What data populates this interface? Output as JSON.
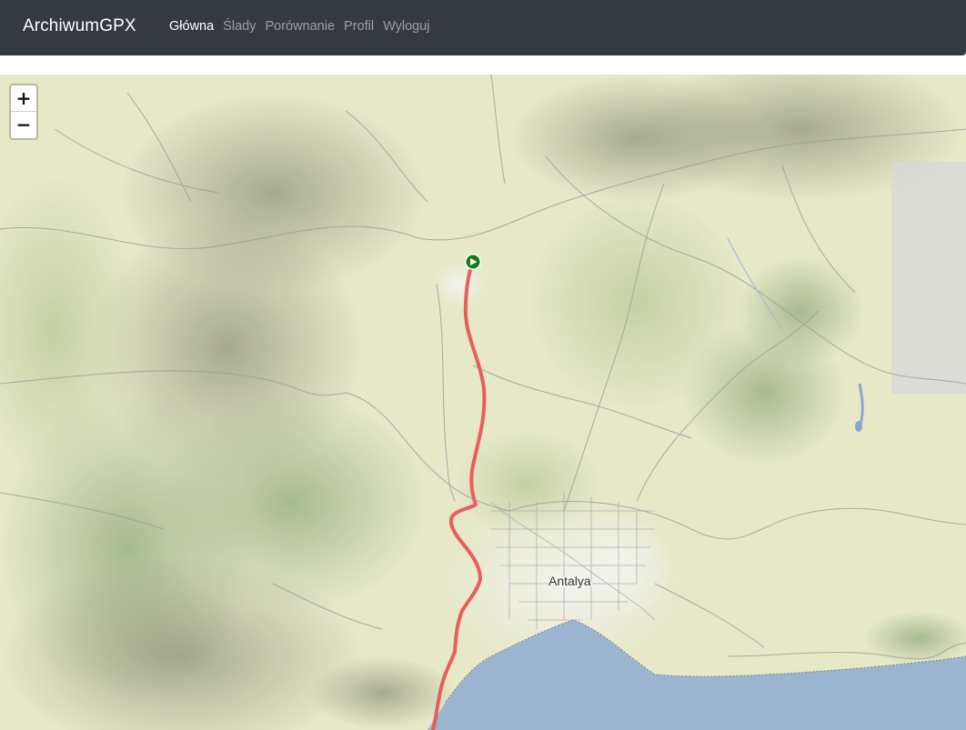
{
  "app": {
    "brand": "ArchiwumGPX"
  },
  "nav": {
    "items": [
      {
        "label": "Główna",
        "active": true
      },
      {
        "label": "Ślady",
        "active": false
      },
      {
        "label": "Porównanie",
        "active": false
      },
      {
        "label": "Profil",
        "active": false
      },
      {
        "label": "Wyloguj",
        "active": false
      }
    ]
  },
  "map": {
    "zoom_in_label": "+",
    "zoom_out_label": "−",
    "city_label": "Antalya",
    "track_color": "#e8565a",
    "start_marker_color": "#1a7a1a",
    "sea_color": "#9bb5d1",
    "terrain_color": "#e6e8c8",
    "start_icon": "play-icon"
  }
}
